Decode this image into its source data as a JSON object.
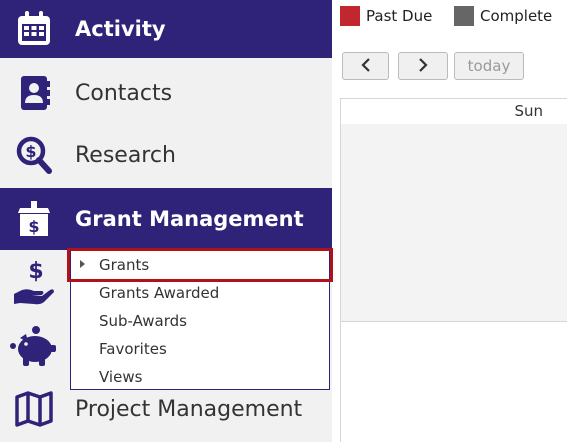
{
  "sidebar": {
    "activity": {
      "label": "Activity",
      "icon": "calendar-icon"
    },
    "contacts": {
      "label": "Contacts",
      "icon": "contact-book-icon"
    },
    "research": {
      "label": "Research",
      "icon": "search-dollar-icon"
    },
    "grant_management": {
      "label": "Grant Management",
      "icon": "dollar-box-icon"
    },
    "funding": {
      "icon": "hand-dollar-icon"
    },
    "savings": {
      "icon": "piggy-bank-icon"
    },
    "project_management": {
      "label": "Project Management",
      "icon": "map-icon"
    }
  },
  "submenu": {
    "items": [
      "Grants",
      "Grants Awarded",
      "Sub-Awards",
      "Favorites",
      "Views"
    ],
    "highlighted": "Grants"
  },
  "calendar": {
    "legend": [
      {
        "label": "Past Due",
        "color": "#c1272d"
      },
      {
        "label": "Complete",
        "color": "#666666"
      }
    ],
    "buttons": {
      "prev": "‹",
      "next": "›",
      "today": "today"
    },
    "day_header": "Sun"
  },
  "colors": {
    "nav_active": "#2f2379",
    "highlight": "#b0121b"
  }
}
